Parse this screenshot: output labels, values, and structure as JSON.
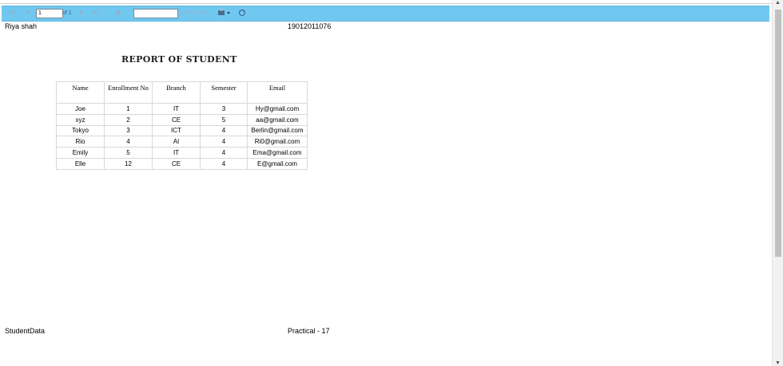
{
  "toolbar": {
    "first_icon": "first-page-icon",
    "prev_icon": "previous-page-icon",
    "page_value": "1",
    "of_label": "of 1",
    "next_icon": "next-page-icon",
    "last_icon": "last-page-icon",
    "back_icon": "back-icon",
    "find_placeholder": "",
    "find_label": "Find",
    "separator": "|",
    "next_label": "Next",
    "export_icon": "export-icon",
    "refresh_icon": "refresh-icon",
    "accent_color": "#70c8f0"
  },
  "page_header": {
    "left": "Riya shah",
    "right": "19012011076"
  },
  "report": {
    "title": "REPORT OF STUDENT",
    "columns": [
      "Name",
      "Enrollment No",
      "Branch",
      "Semester",
      "Email"
    ],
    "rows": [
      [
        "Joe",
        "1",
        "IT",
        "3",
        "Hy@gmail.com"
      ],
      [
        "xyz",
        "2",
        "CE",
        "5",
        "aa@gmail.com"
      ],
      [
        "Tokyo",
        "3",
        "ICT",
        "4",
        "Berlin@gmail.com"
      ],
      [
        "Rio",
        "4",
        "AI",
        "4",
        "Ri0@gmail.com"
      ],
      [
        "Emily",
        "5",
        "IT",
        "4",
        "Ema@gmail.com"
      ],
      [
        "Elle",
        "12",
        "CE",
        "4",
        "E@gmail.com"
      ]
    ]
  },
  "page_footer": {
    "left": "StudentData",
    "right": "Practical - 17"
  }
}
